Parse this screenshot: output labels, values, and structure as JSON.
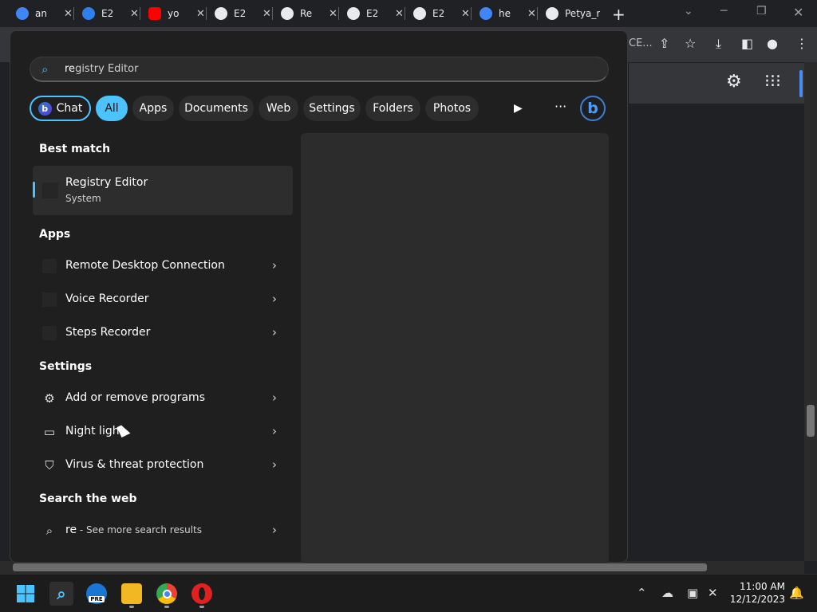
{
  "browser": {
    "tabs": [
      {
        "label": "an",
        "icon": "google-icon",
        "color": "#4285f4"
      },
      {
        "label": "E2",
        "icon": "edge-icon",
        "color": "#2f80ed"
      },
      {
        "label": "yo",
        "icon": "youtube-icon",
        "color": "#ff0000"
      },
      {
        "label": "E2",
        "icon": "github-icon",
        "color": "#e8eaed"
      },
      {
        "label": "Re",
        "icon": "github-icon",
        "color": "#e8eaed"
      },
      {
        "label": "E2",
        "icon": "github-icon",
        "color": "#e8eaed"
      },
      {
        "label": "E2",
        "icon": "github-icon",
        "color": "#e8eaed"
      },
      {
        "label": "he",
        "icon": "google-icon",
        "color": "#4285f4"
      },
      {
        "label": "Petya_r",
        "icon": "github-icon",
        "color": "#e8eaed"
      }
    ],
    "address_fragment": "CE...",
    "close_glyph": "✕",
    "new_tab_glyph": "+"
  },
  "search": {
    "typed": "re",
    "suggestion": "gistry Editor"
  },
  "filters": [
    {
      "label": "Chat"
    },
    {
      "label": "All"
    },
    {
      "label": "Apps"
    },
    {
      "label": "Documents"
    },
    {
      "label": "Web"
    },
    {
      "label": "Settings"
    },
    {
      "label": "Folders"
    },
    {
      "label": "Photos"
    }
  ],
  "bing_letter": "b",
  "sections": {
    "best_match": "Best match",
    "apps": "Apps",
    "settings": "Settings",
    "web": "Search the web"
  },
  "best_match": {
    "name": "Registry Editor",
    "subtitle": "System"
  },
  "apps": [
    {
      "label": "Remote Desktop Connection"
    },
    {
      "label": "Voice Recorder"
    },
    {
      "label": "Steps Recorder"
    }
  ],
  "settings": [
    {
      "label": "Add or remove programs",
      "icon": "gear-icon"
    },
    {
      "label": "Night light",
      "icon": "laptop-icon"
    },
    {
      "label": "Virus & threat protection",
      "icon": "shield-icon"
    }
  ],
  "web": {
    "term": "re",
    "suffix": " - See more search results"
  },
  "taskbar": {
    "time": "11:00 AM",
    "date": "12/12/2023",
    "edge_badge": "PRE"
  },
  "colors": {
    "accent": "#4cc2ff",
    "panel": "#1f1f1f"
  }
}
